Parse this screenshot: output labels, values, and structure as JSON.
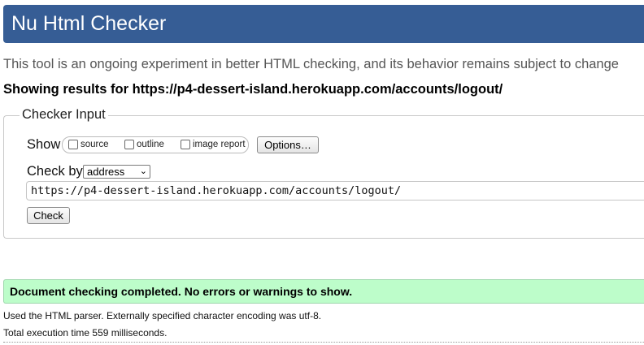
{
  "header": {
    "title": "Nu Html Checker"
  },
  "intro": {
    "tagline": "This tool is an ongoing experiment in better HTML checking, and its behavior remains subject to change",
    "results_for": "Showing results for https://p4-dessert-island.herokuapp.com/accounts/logout/"
  },
  "checker_input": {
    "legend": "Checker Input",
    "show_label": "Show",
    "show_options": [
      {
        "label": "source",
        "checked": false
      },
      {
        "label": "outline",
        "checked": false
      },
      {
        "label": "image report",
        "checked": false
      }
    ],
    "options_button": "Options…",
    "check_by_label": "Check by",
    "check_by_value": "address",
    "url_value": "https://p4-dessert-island.herokuapp.com/accounts/logout/",
    "check_button": "Check"
  },
  "results": {
    "success_message": "Document checking completed. No errors or warnings to show.",
    "parser_note": "Used the HTML parser. Externally specified character encoding was utf-8.",
    "time_note": "Total execution time 559 milliseconds."
  },
  "colors": {
    "header_bg": "#365d95",
    "success_bg": "#bdfdca"
  }
}
